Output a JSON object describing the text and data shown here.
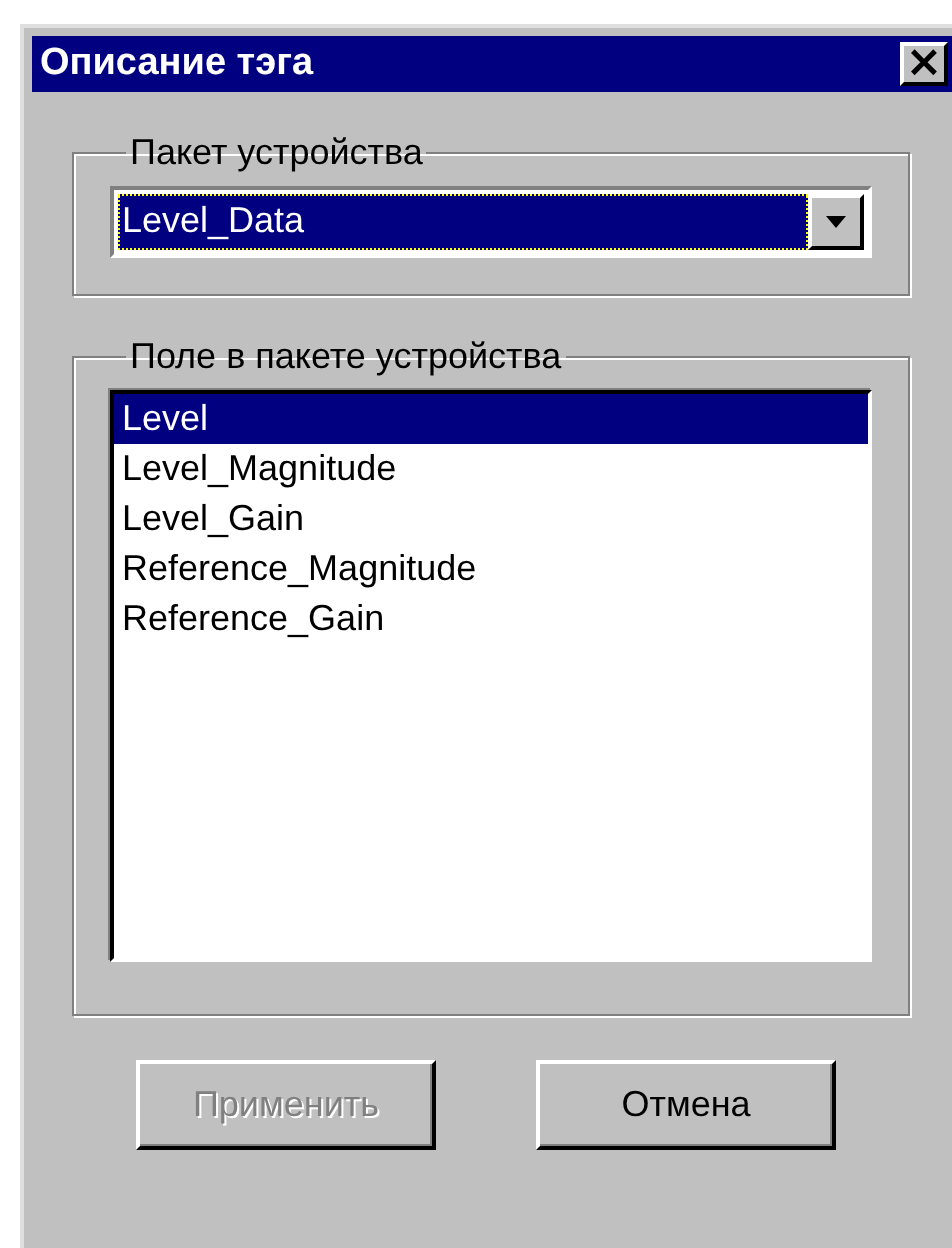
{
  "window": {
    "title": "Описание тэга",
    "close": "×"
  },
  "device_package": {
    "label": "Пакет устройства",
    "value": "Level_Data",
    "focused": true
  },
  "package_field": {
    "label": "Поле в пакете устройства",
    "items": [
      {
        "label": "Level",
        "selected": true
      },
      {
        "label": "Level_Magnitude",
        "selected": false
      },
      {
        "label": "Level_Gain",
        "selected": false
      },
      {
        "label": "Reference_Magnitude",
        "selected": false
      },
      {
        "label": "Reference_Gain",
        "selected": false
      }
    ]
  },
  "buttons": [
    {
      "label": "Применить",
      "disabled": true
    },
    {
      "label": "Отмена",
      "disabled": false
    }
  ]
}
